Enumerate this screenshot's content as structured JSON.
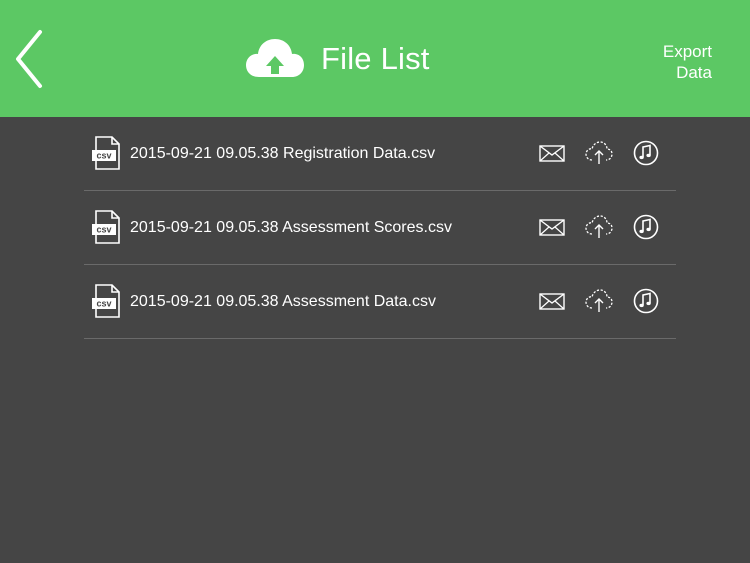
{
  "header": {
    "title": "File List",
    "export_line1": "Export",
    "export_line2": "Data",
    "brand_color": "#5cc864",
    "back_icon": "chevron-left-icon",
    "logo_icon": "cloud-upload-icon"
  },
  "files": [
    {
      "name": "2015-09-21 09.05.38 Registration Data.csv",
      "type_label": "csv"
    },
    {
      "name": "2015-09-21 09.05.38 Assessment Scores.csv",
      "type_label": "csv"
    },
    {
      "name": "2015-09-21 09.05.38 Assessment Data.csv",
      "type_label": "csv"
    }
  ],
  "row_actions": [
    "email-icon",
    "cloud-upload-icon",
    "music-note-icon"
  ],
  "colors": {
    "background": "#454545",
    "divider": "#6a6a6a",
    "text": "#ffffff"
  }
}
